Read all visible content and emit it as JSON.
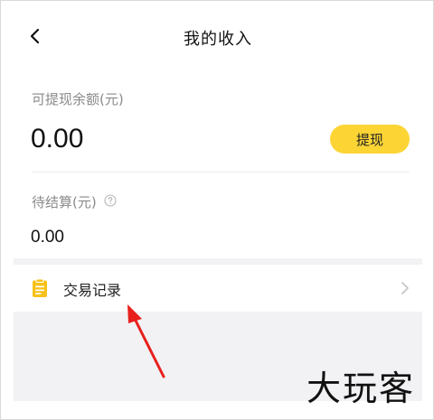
{
  "header": {
    "title": "我的收入",
    "back_icon": "back-arrow-icon"
  },
  "balance": {
    "withdrawable_label": "可提现余额(元)",
    "withdrawable_amount": "0.00",
    "withdraw_button": "提现",
    "pending_label": "待结算(元)",
    "pending_amount": "0.00",
    "help_icon": "question-circle-icon"
  },
  "records": {
    "label": "交易记录",
    "icon": "clipboard-icon",
    "chevron_icon": "chevron-right-icon"
  },
  "annotation": {
    "arrow_color": "#e8201c"
  },
  "watermark": {
    "text": "大玩客"
  },
  "colors": {
    "accent_yellow": "#fcd535",
    "icon_yellow": "#f7c21b",
    "page_background": "#f2f2f4"
  }
}
